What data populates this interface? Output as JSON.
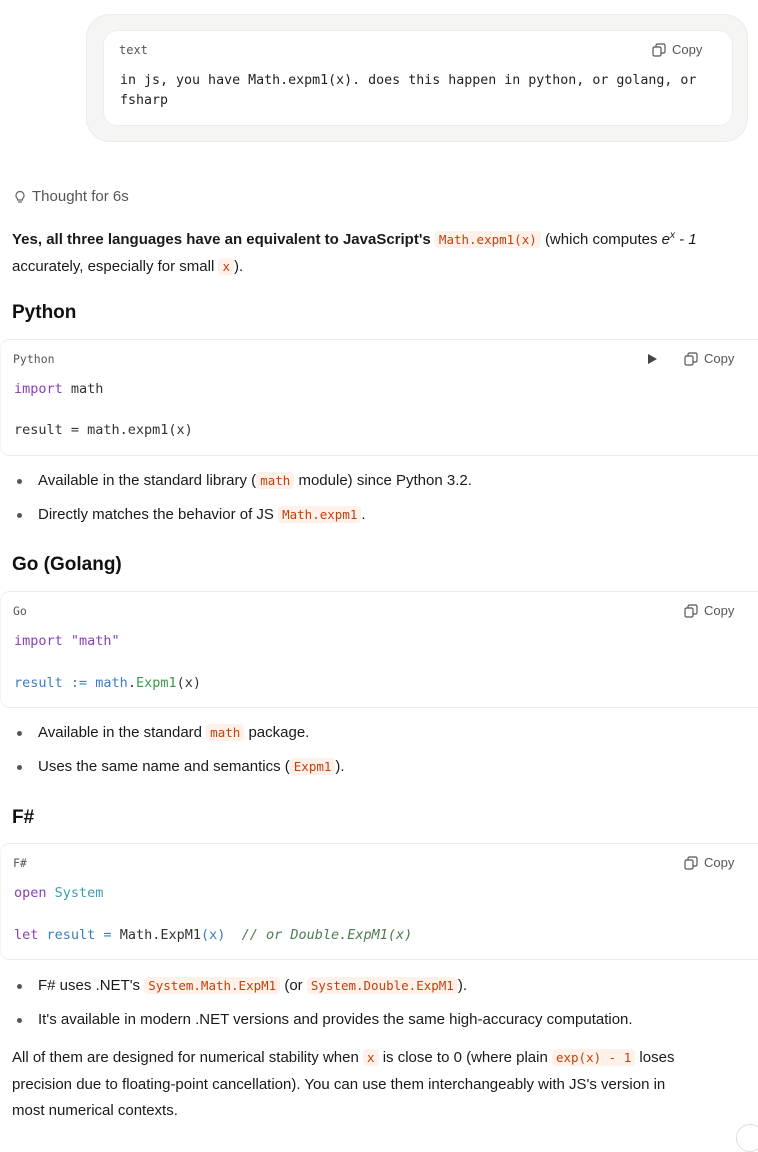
{
  "user_message": {
    "lang": "text",
    "copy_label": "Copy",
    "text": "in js, you have Math.expm1(x). does this happen in python, or golang, or\nfsharp"
  },
  "thought": {
    "label": "Thought for 6s"
  },
  "intro": {
    "bold": "Yes, all three languages have an equivalent to JavaScript's",
    "code": "Math.expm1(x)",
    "after_code": "(which computes",
    "math": "e",
    "sup": "x",
    "math_rest": " - 1",
    "line2_pre": "accurately, especially for small",
    "line2_code": "x",
    "line2_post": ")."
  },
  "python": {
    "heading": "Python",
    "lang": "Python",
    "copy_label": "Copy",
    "line1_kw": "import",
    "line1_rest": " math",
    "line2": "result = math.expm1(x)",
    "bullets": [
      {
        "pre": "Available in the standard library (",
        "code": "math",
        "post": " module) since Python 3.2."
      },
      {
        "pre": "Directly matches the behavior of JS ",
        "code": "Math.expm1",
        "post": "."
      }
    ]
  },
  "go": {
    "heading": "Go (Golang)",
    "lang": "Go",
    "copy_label": "Copy",
    "line1_kw": "import",
    "line1_str": " \"math\"",
    "line2_var": "result",
    "line2_op": " := ",
    "line2_pkg": "math",
    "line2_dot": ".",
    "line2_fn": "Expm1",
    "line2_args": "(x)",
    "bullets": [
      {
        "pre": "Available in the standard ",
        "code": "math",
        "post": " package."
      },
      {
        "pre": "Uses the same name and semantics (",
        "code": "Expm1",
        "post": ")."
      }
    ]
  },
  "fsharp": {
    "heading": "F#",
    "lang": "F#",
    "copy_label": "Copy",
    "line1_kw": "open",
    "line1_typ": " System",
    "line2_kw": "let",
    "line2_var": " result",
    "line2_op": " = ",
    "line2_call": "Math.ExpM1",
    "line2_args": "(x)",
    "line2_comment": "  // or Double.ExpM1(x)",
    "bullets": [
      {
        "pre": "F# uses .NET's ",
        "code": "System.Math.ExpM1",
        "mid": " (or ",
        "code2": "System.Double.ExpM1",
        "post": ")."
      },
      {
        "pre": "It's available in modern .NET versions and provides the same high-accuracy computation.",
        "code": "",
        "post": ""
      }
    ]
  },
  "conclusion": {
    "pre": "All of them are designed for numerical stability when",
    "code": "x",
    "mid": "is close to 0 (where plain",
    "code2": "exp(x) - 1",
    "post": "loses",
    "line2": "precision due to floating-point cancellation). You can use them interchangeably with JS's version in",
    "line3": "most numerical contexts."
  }
}
